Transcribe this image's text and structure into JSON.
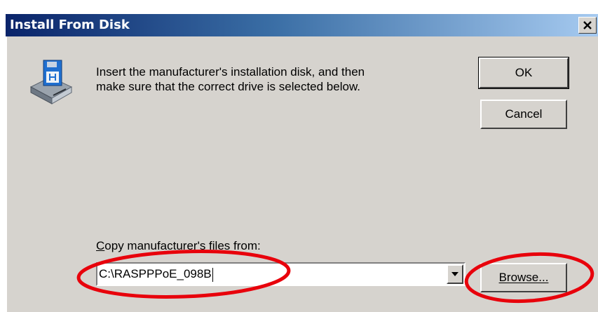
{
  "dialog": {
    "title": "Install From Disk",
    "close_glyph": "×"
  },
  "message": {
    "text": "Insert the manufacturer's installation disk, and then\nmake sure that the correct drive is selected below."
  },
  "buttons": {
    "ok": "OK",
    "cancel": "Cancel",
    "browse": "Browse..."
  },
  "copy_from": {
    "label_accel": "C",
    "label_rest": "opy manufacturer's files from:",
    "value": "C:\\RASPPPoE_098B"
  },
  "icons": {
    "dialog_icon": "floppy-disk-drive-icon",
    "dropdown": "chevron-down-icon"
  },
  "annotations": {
    "highlight_color": "#e8000b"
  }
}
